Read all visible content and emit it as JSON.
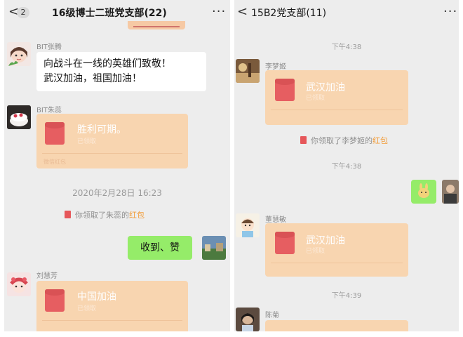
{
  "left": {
    "header": {
      "back_glyph": "<",
      "unread_count": "2",
      "title": "16级博士二班党支部(22)",
      "more_glyph": "···"
    },
    "messages": {
      "m1": {
        "sender": "BIT张腾",
        "text_line1": "向战斗在一线的英雄们致敬！",
        "text_line2": "武汉加油，祖国加油！"
      },
      "m2": {
        "sender": "BIT朱蕊",
        "title": "胜利可期。",
        "sub": "已领取",
        "footer": "微信红包"
      },
      "timestamp": "2020年2月28日 16:23",
      "sys1": {
        "prefix": "你领取了朱蕊的",
        "highlight": "红包"
      },
      "m3": {
        "text": "收到、赞"
      },
      "m4": {
        "sender": "刘慧芳",
        "title": "中国加油",
        "sub": "已领取"
      }
    }
  },
  "right": {
    "header": {
      "back_glyph": "<",
      "title": "15B2党支部(11)",
      "more_glyph": "···"
    },
    "messages": {
      "time1": "下午4:38",
      "r1": {
        "sender": "李梦姬",
        "title": "武汉加油",
        "sub": "已领取"
      },
      "sys1": {
        "prefix": "你领取了李梦姬的",
        "highlight": "红包"
      },
      "time2": "下午4:38",
      "r2": {
        "sender": "董慧敏",
        "title": "武汉加油",
        "sub": "已领取"
      },
      "time3": "下午4:39",
      "r3": {
        "sender": "陈菊"
      }
    }
  },
  "colors": {
    "chat_bg": "#ededed",
    "green_bubble": "#95ec69",
    "red_packet": "#f9d4ad",
    "link": "#f29c38"
  }
}
